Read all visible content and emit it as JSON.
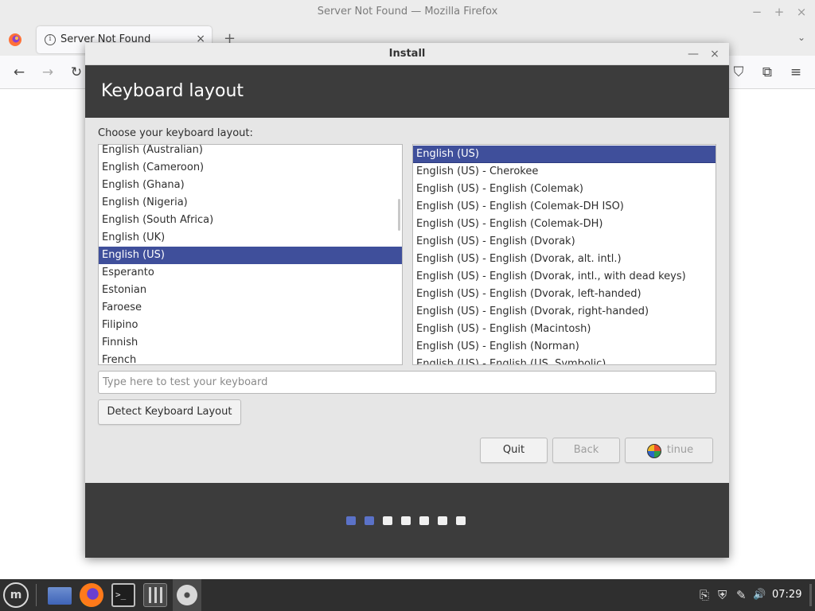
{
  "firefox": {
    "window_title": "Server Not Found — Mozilla Firefox",
    "tab_title": "Server Not Found",
    "tab_close": "×",
    "new_tab": "+",
    "tab_list": "⌄",
    "minimize": "−",
    "maximize": "+",
    "close": "×",
    "nav": {
      "back": "←",
      "forward": "→",
      "reload": "↻",
      "pocket": "⛉",
      "extensions": "⧉",
      "menu": "≡"
    }
  },
  "dialog": {
    "title": "Install",
    "minimize": "—",
    "close": "×",
    "heading": "Keyboard layout",
    "choose_label": "Choose your keyboard layout:",
    "layouts": [
      "English (Australian)",
      "English (Cameroon)",
      "English (Ghana)",
      "English (Nigeria)",
      "English (South Africa)",
      "English (UK)",
      "English (US)",
      "Esperanto",
      "Estonian",
      "Faroese",
      "Filipino",
      "Finnish",
      "French"
    ],
    "variants": [
      "English (US)",
      "English (US) - Cherokee",
      "English (US) - English (Colemak)",
      "English (US) - English (Colemak-DH ISO)",
      "English (US) - English (Colemak-DH)",
      "English (US) - English (Dvorak)",
      "English (US) - English (Dvorak, alt. intl.)",
      "English (US) - English (Dvorak, intl., with dead keys)",
      "English (US) - English (Dvorak, left-handed)",
      "English (US) - English (Dvorak, right-handed)",
      "English (US) - English (Macintosh)",
      "English (US) - English (Norman)",
      "English (US) - English (US, Symbolic)"
    ],
    "selected_layout": "English (US)",
    "selected_variant": "English (US)",
    "test_input": {
      "value": "",
      "placeholder": "Type here to test your keyboard"
    },
    "buttons": {
      "detect": "Detect Keyboard Layout",
      "quit": "Quit",
      "back": "Back",
      "continue": "tinue"
    },
    "progress": {
      "total_steps": 7,
      "completed_steps": 2
    }
  },
  "taskbar": {
    "menu_icon": "m",
    "terminal_glyph": ">_",
    "tray": {
      "clipboard": "⎘",
      "shield": "⛨",
      "pen": "✎",
      "volume": "🔊"
    },
    "clock": "07:29"
  },
  "colors": {
    "selection": "#3f4f9b",
    "header_bg": "#3c3c3c",
    "dot_active": "#5b72c8",
    "dot_inactive": "#f0f0f0"
  }
}
